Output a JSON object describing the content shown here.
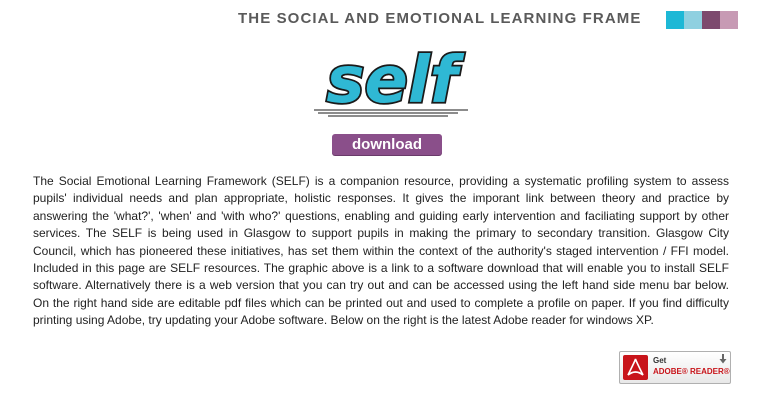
{
  "header": {
    "title": "THE SOCIAL AND EMOTIONAL LEARNING FRAME",
    "swatch_colors": [
      "#1db8d6",
      "#8fd0e0",
      "#7d4a6e",
      "#c79ab4"
    ]
  },
  "logo": {
    "text": "self",
    "fill_color": "#2fb8d4",
    "outline_color": "#1a1a1a"
  },
  "download": {
    "label": "download",
    "color": "#8a4f8a"
  },
  "body": {
    "paragraph": "The Social Emotional Learning Framework (SELF) is a companion resource, providing a systematic profiling system to assess pupils' individual needs and plan appropriate, holistic responses. It gives the imporant link between theory and practice by answering the 'what?', 'when' and 'with who?' questions, enabling and guiding early intervention and faciliating support by other services. The SELF is being used in Glasgow to support pupils in making the primary to secondary transition. Glasgow City Council, which has pioneered these initiatives, has set them within the context of the authority's staged intervention / FFI model. Included in this page are SELF resources. The graphic above is a link to a software download that will enable you to install SELF software. Alternatively there is a web version that you can try out and can be accessed using the left hand side menu bar below. On the right hand side are editable pdf files which can be printed out and used to complete a profile on paper. If you find difficulty printing using Adobe, try updating your Adobe software. Below on the right is the latest Adobe reader for windows XP."
  },
  "adobe_badge": {
    "get_label": "Get",
    "reader_label": "ADOBE® READER®",
    "accent_color": "#c8141a"
  }
}
